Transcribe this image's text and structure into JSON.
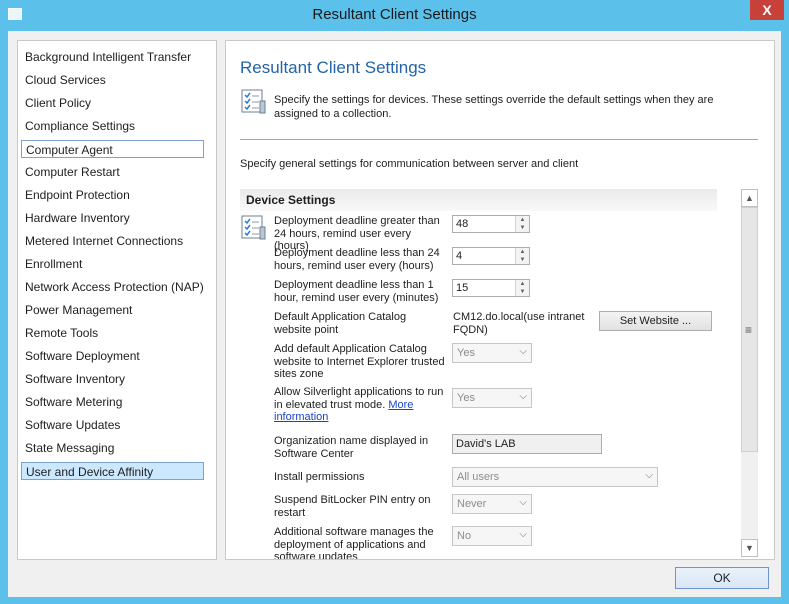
{
  "window": {
    "title": "Resultant Client Settings",
    "close": "X"
  },
  "sidebar": {
    "items": [
      "Background Intelligent Transfer",
      "Cloud Services",
      "Client Policy",
      "Compliance Settings",
      "Computer Agent",
      "Computer Restart",
      "Endpoint Protection",
      "Hardware Inventory",
      "Metered Internet Connections",
      "Enrollment",
      "Network Access Protection (NAP)",
      "Power Management",
      "Remote Tools",
      "Software Deployment",
      "Software Inventory",
      "Software Metering",
      "Software Updates",
      "State Messaging",
      "User and Device Affinity"
    ]
  },
  "main": {
    "title": "Resultant Client Settings",
    "description": "Specify the settings for devices. These settings override the default settings when they are assigned to a collection.",
    "general": "Specify general settings for communication between server and client",
    "section": "Device Settings",
    "settings": {
      "deadline_gt24_label": "Deployment deadline greater than 24 hours, remind user every (hours)",
      "deadline_gt24_value": "48",
      "deadline_lt24_label": "Deployment deadline less than 24 hours, remind user every (hours)",
      "deadline_lt24_value": "4",
      "deadline_lt1_label": "Deployment deadline less than 1 hour, remind user every (minutes)",
      "deadline_lt1_value": "15",
      "catalog_label": "Default Application Catalog website point",
      "catalog_value": "CM12.do.local(use intranet FQDN)",
      "set_website": "Set Website ...",
      "add_trusted_label": "Add default Application Catalog website to Internet Explorer trusted sites zone",
      "add_trusted_value": "Yes",
      "silverlight_label": "Allow Silverlight applications to run in elevated trust mode.",
      "silverlight_link": "More information",
      "silverlight_value": "Yes",
      "org_label": "Organization name displayed in Software Center",
      "org_value": "David's LAB",
      "install_perm_label": "Install permissions",
      "install_perm_value": "All users",
      "bitlocker_label": "Suspend BitLocker PIN entry on restart",
      "bitlocker_value": "Never",
      "additional_label": "Additional software manages the deployment of applications and software updates",
      "additional_value": "No"
    }
  },
  "footer": {
    "ok": "OK"
  },
  "colors": {
    "titlebar": "#5bc1ea",
    "accent_title": "#2463a7",
    "selected": "#cce8ff",
    "close": "#c7413a"
  }
}
